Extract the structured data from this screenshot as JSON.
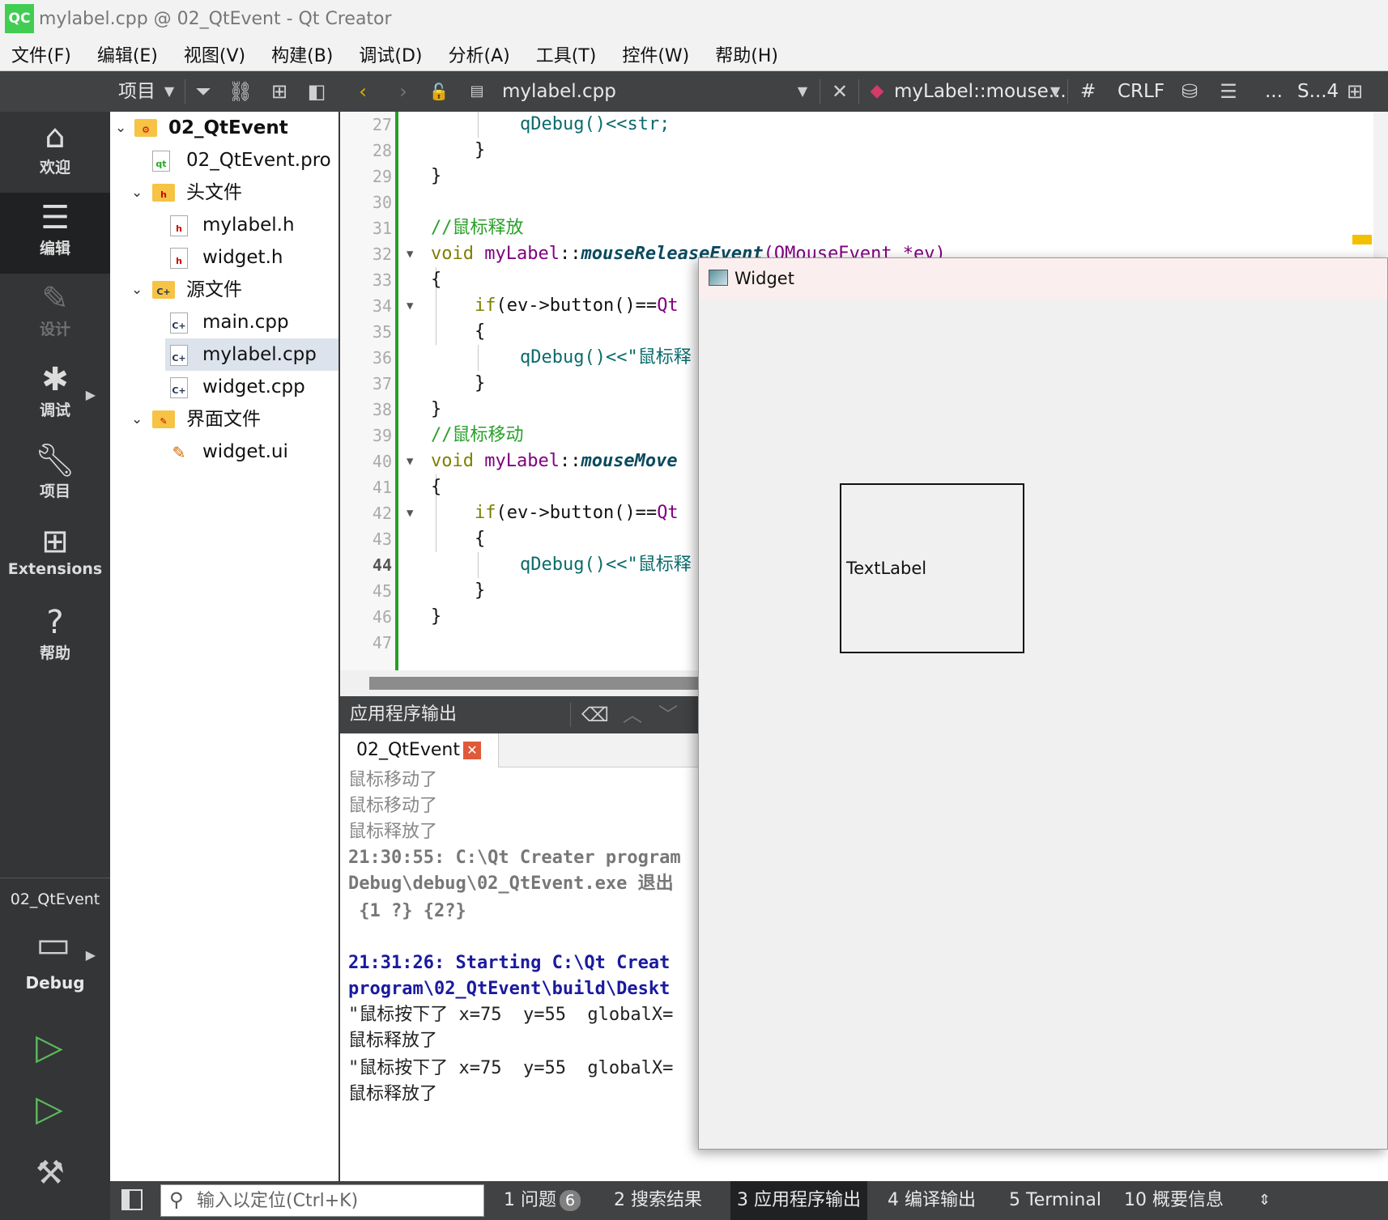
{
  "window": {
    "title": "mylabel.cpp @ 02_QtEvent - Qt Creator",
    "logo": "QC"
  },
  "menubar": [
    "文件(F)",
    "编辑(E)",
    "视图(V)",
    "构建(B)",
    "调试(D)",
    "分析(A)",
    "工具(T)",
    "控件(W)",
    "帮助(H)"
  ],
  "toolbar": {
    "project_label": "项目",
    "file_name": "mylabel.cpp",
    "symbol": "myLabel::mouse...",
    "hash": "#",
    "line_ending": "CRLF",
    "ellipsis": "...",
    "position": "S...4"
  },
  "modes": [
    {
      "label": "欢迎",
      "icon": "home-icon"
    },
    {
      "label": "编辑",
      "icon": "edit-lines-icon"
    },
    {
      "label": "设计",
      "icon": "pen-icon"
    },
    {
      "label": "调试",
      "icon": "bug-icon"
    },
    {
      "label": "项目",
      "icon": "wrench-icon"
    },
    {
      "label": "Extensions",
      "icon": "extensions-icon"
    },
    {
      "label": "帮助",
      "icon": "help-icon"
    }
  ],
  "kit": {
    "project": "02_QtEvent",
    "config": "Debug"
  },
  "tree": {
    "root": "02_QtEvent",
    "pro": "02_QtEvent.pro",
    "headers": "头文件",
    "header_files": [
      "mylabel.h",
      "widget.h"
    ],
    "sources": "源文件",
    "source_files": [
      "main.cpp",
      "mylabel.cpp",
      "widget.cpp"
    ],
    "forms": "界面文件",
    "form_files": [
      "widget.ui"
    ]
  },
  "editor": {
    "line_numbers": [
      "27",
      "28",
      "29",
      "30",
      "31",
      "32",
      "33",
      "34",
      "35",
      "36",
      "37",
      "38",
      "39",
      "40",
      "41",
      "42",
      "43",
      "44",
      "45",
      "46",
      "47"
    ],
    "current_line": "44",
    "line27": "qDebug()<<str;",
    "brace_close": "}",
    "brace_open": "{",
    "comment_release": "//鼠标释放",
    "comment_move": "//鼠标移动",
    "kw_void": "void",
    "cls_mylabel": "myLabel",
    "scope": "::",
    "fn_release": "mouseReleaseEvent",
    "release_args": "(QMouseEvent *ev)",
    "fn_move": "mouseMove",
    "kw_if": "if",
    "if_cond": "(ev->button()==",
    "qt_ns": "Qt",
    "qdebug": "qDebug",
    "qdebug_tail": "()<<\"鼠标释"
  },
  "output": {
    "title": "应用程序输出",
    "tab": "02_QtEvent",
    "lines": [
      {
        "text": "鼠标移动了",
        "style": "gray"
      },
      {
        "text": "鼠标移动了",
        "style": "gray"
      },
      {
        "text": "鼠标释放了",
        "style": "gray"
      },
      {
        "text": "21:30:55: C:\\Qt Creater program",
        "style": "bgray"
      },
      {
        "text": "Debug\\debug\\02_QtEvent.exe 退出",
        "style": "bgray"
      },
      {
        "text": " {1 ?} {2?}",
        "style": "bgray"
      },
      {
        "text": "",
        "style": "gray"
      },
      {
        "text": "21:31:26: Starting C:\\Qt Creat",
        "style": "blue"
      },
      {
        "text": "program\\02_QtEvent\\build\\Deskt",
        "style": "blue"
      },
      {
        "text": "\"鼠标按下了 x=75  y=55  globalX=",
        "style": "dark"
      },
      {
        "text": "鼠标释放了",
        "style": "dark"
      },
      {
        "text": "\"鼠标按下了 x=75  y=55  globalX=",
        "style": "dark"
      },
      {
        "text": "鼠标释放了",
        "style": "dark"
      }
    ]
  },
  "statusbar": {
    "locator_placeholder": "输入以定位(Ctrl+K)",
    "items": [
      "1  问题",
      "2  搜索结果",
      "3  应用程序输出",
      "4  编译输出",
      "5  Terminal",
      "10  概要信息"
    ],
    "issues_count": "6"
  },
  "widget_window": {
    "title": "Widget",
    "label": "TextLabel"
  }
}
